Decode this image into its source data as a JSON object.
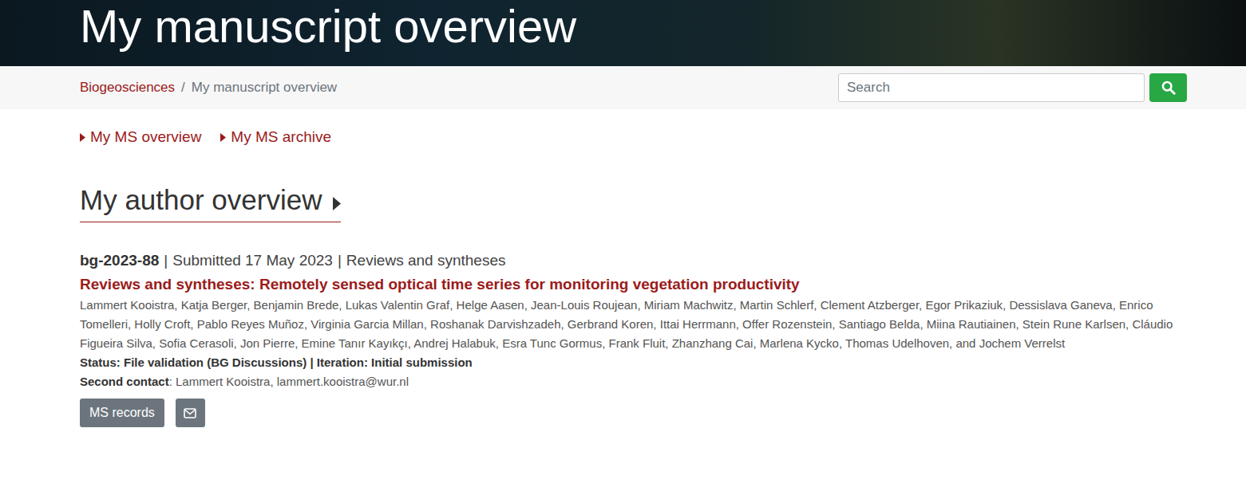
{
  "header": {
    "title": "My manuscript overview"
  },
  "breadcrumb": {
    "items": [
      "Biogeosciences",
      "My manuscript overview"
    ],
    "separator": "/"
  },
  "search": {
    "placeholder": "Search"
  },
  "nav": [
    {
      "label": "My MS overview"
    },
    {
      "label": "My MS archive"
    }
  ],
  "section": {
    "title": "My author overview"
  },
  "manuscripts": [
    {
      "id": "bg-2023-88",
      "separator": "|",
      "submitted": "Submitted 17 May 2023",
      "type": "Reviews and syntheses",
      "title": "Reviews and syntheses: Remotely sensed optical time series for monitoring vegetation productivity",
      "authors": "Lammert Kooistra, Katja Berger, Benjamin Brede, Lukas Valentin Graf, Helge Aasen, Jean-Louis Roujean, Miriam Machwitz, Martin Schlerf, Clement Atzberger, Egor Prikaziuk, Dessislava Ganeva, Enrico Tomelleri, Holly Croft, Pablo Reyes Muñoz, Virginia Garcia Millan, Roshanak Darvishzadeh, Gerbrand Koren, Ittai Herrmann, Offer Rozenstein, Santiago Belda, Miina Rautiainen, Stein Rune Karlsen, Cláudio Figueira Silva, Sofia Cerasoli, Jon Pierre, Emine Tanır Kayıkçı, Andrej Halabuk, Esra Tunc Gormus, Frank Fluit, Zhanzhang Cai, Marlena Kycko, Thomas Udelhoven, and Jochem Verrelst",
      "status": "Status: File validation (BG Discussions) | Iteration: Initial submission",
      "contact_label": "Second contact",
      "contact": ": Lammert Kooistra, lammert.kooistra@wur.nl",
      "buttons": [
        "MS records"
      ]
    }
  ]
}
